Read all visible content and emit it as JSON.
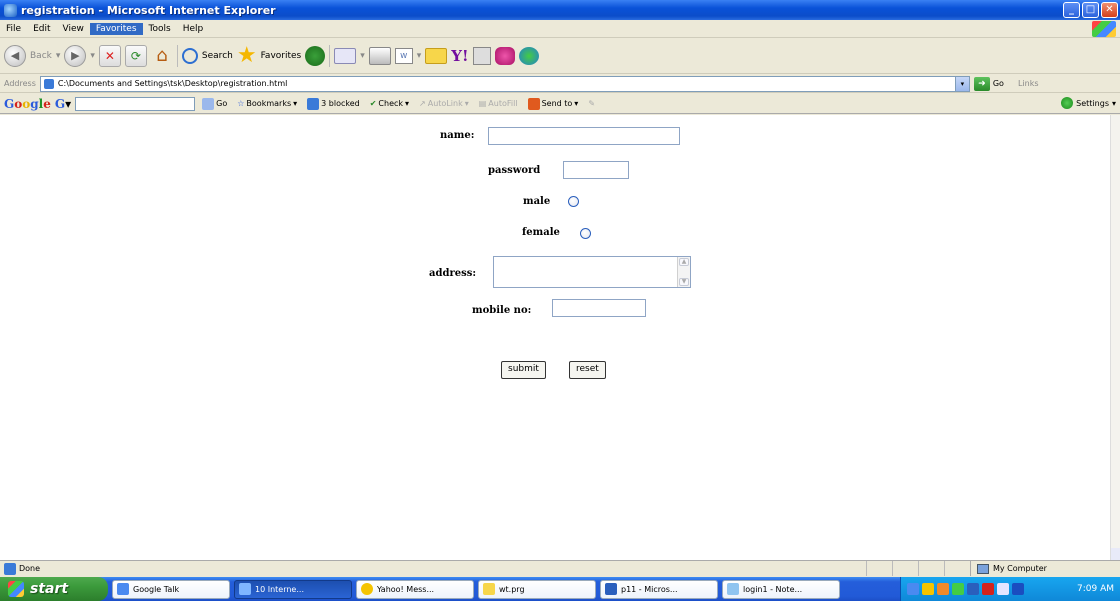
{
  "window": {
    "title": "registration - Microsoft Internet Explorer"
  },
  "menu": {
    "items": [
      "File",
      "Edit",
      "View",
      "Favorites",
      "Tools",
      "Help"
    ]
  },
  "toolbar": {
    "back_label": "Back",
    "search_label": "Search",
    "favorites_label": "Favorites"
  },
  "address": {
    "label": "Address",
    "url": "C:\\Documents and Settings\\tsk\\Desktop\\registration.html",
    "go_label": "Go",
    "links_label": "Links"
  },
  "google_toolbar": {
    "go_label": "Go",
    "bookmarks_label": "Bookmarks",
    "blocked_label": "3 blocked",
    "check_label": "Check",
    "autolink_label": "AutoLink",
    "autofill_label": "AutoFill",
    "sendto_label": "Send to",
    "settings_label": "Settings"
  },
  "form": {
    "name_label": "name:",
    "password_label": "password",
    "male_label": "male",
    "female_label": "female",
    "address_label": "address:",
    "mobile_label": "mobile no:",
    "submit_label": "submit",
    "reset_label": "reset"
  },
  "status": {
    "text": "Done",
    "zone": "My Computer"
  },
  "taskbar": {
    "start_label": "start",
    "tasks": [
      "Google Talk",
      "10 Interne...",
      "Yahoo! Mess...",
      "wt.prg",
      "p11 - Micros...",
      "login1 - Note..."
    ],
    "clock": "7:09 AM"
  },
  "colors": {
    "titlebar": "#0a52d8",
    "taskbar": "#245edb",
    "start": "#3b9a3b"
  }
}
